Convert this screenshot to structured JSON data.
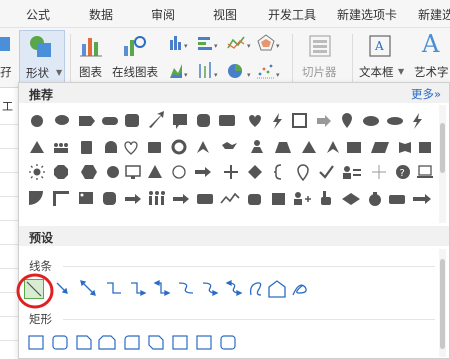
{
  "menu": {
    "tabs": [
      "公式",
      "数据",
      "审阅",
      "视图",
      "开发工具",
      "新建选项卡",
      "新建选"
    ]
  },
  "ribbon": {
    "partial_label": "孖",
    "shape_label": "形状",
    "chart_label": "图表",
    "online_chart_label": "在线图表",
    "screenshot_label": "切片器",
    "textbox_label": "文本框",
    "art_label": "艺术字",
    "doc_partial": "工"
  },
  "panel": {
    "recommended_title": "推荐",
    "more_label": "更多»",
    "preset_title": "预设",
    "lines_label": "线条",
    "rect_label": "矩形"
  },
  "colors": {
    "accent_green": "#5aa64b",
    "highlight_circle": "#e02020",
    "link_blue": "#2b6cc4",
    "shape_gray": "#555555"
  }
}
